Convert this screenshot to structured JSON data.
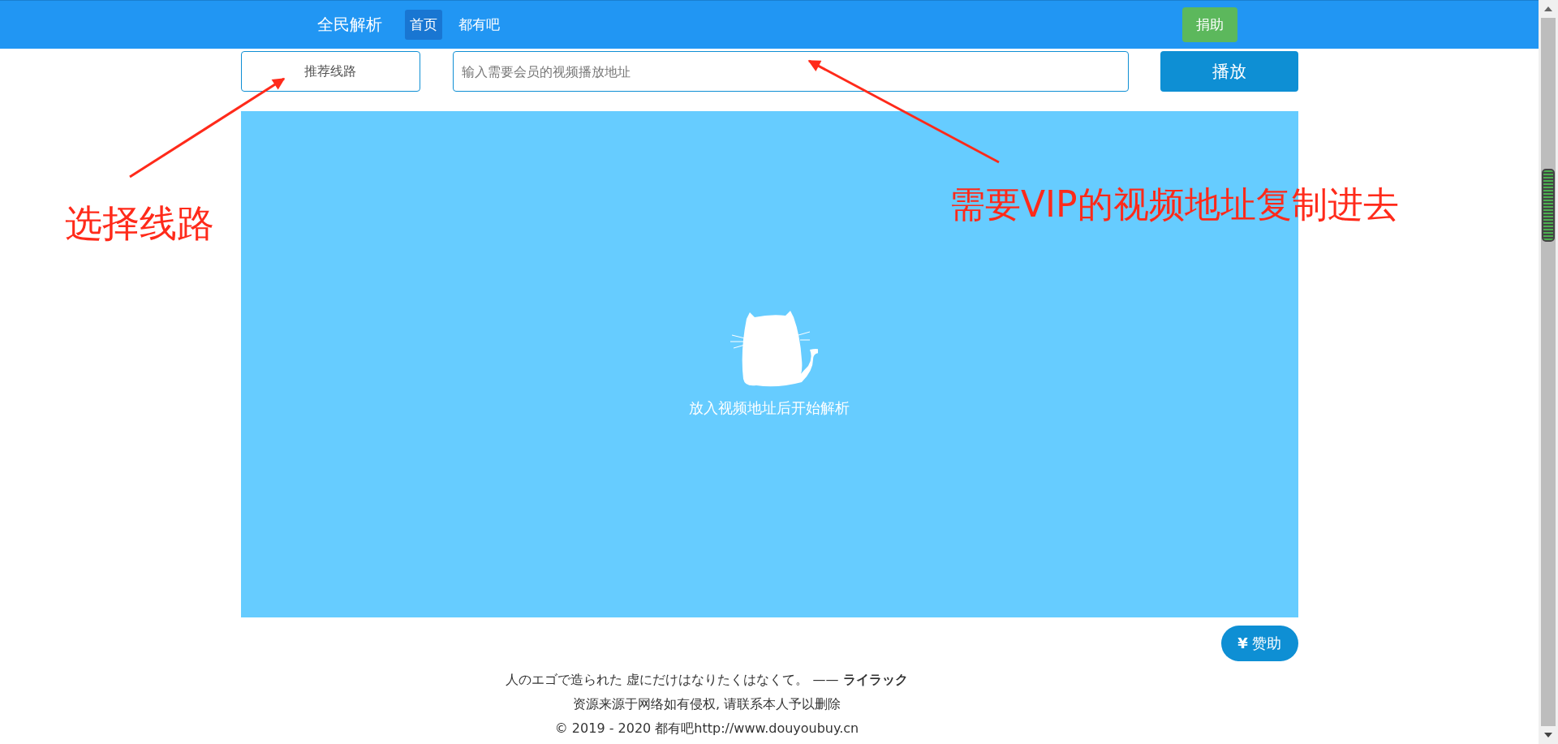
{
  "navbar": {
    "brand": "全民解析",
    "links": [
      {
        "label": "首页",
        "selected": true
      },
      {
        "label": "都有吧",
        "selected": false
      }
    ],
    "donate_button": "捐助"
  },
  "controls": {
    "line_select": "推荐线路",
    "url_input": {
      "placeholder": "输入需要会员的视频播放地址"
    },
    "play_button": "播放"
  },
  "player": {
    "message": "放入视频地址后开始解析"
  },
  "sponsor_button": "**¥** 赞助",
  "footer": {
    "quote": "人のエゴで造られた 虚にだけはなりたくはなくて。 —— **ライラック**",
    "disclaimer": "资源来源于网络如有侵权, 请联系本人予以删除",
    "copyright": "© 2019 - 2020 都有吧http://www.douyoubuy.cn"
  },
  "annotations": [
    {
      "text": "选择线路"
    },
    {
      "text": "需要VIP的视频地址复制进去"
    }
  ]
}
